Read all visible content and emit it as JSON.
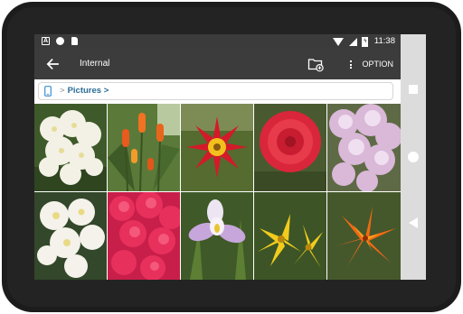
{
  "status_bar": {
    "time": "11:38",
    "battery_icon": "battery-charging-icon",
    "left_icons": [
      "text-app-notification-icon",
      "circle-app-notification-icon",
      "sd-card-icon"
    ]
  },
  "toolbar": {
    "title": "Internal",
    "back_icon": "arrow-back-icon",
    "new_folder_icon": "new-folder-icon",
    "option_label": "OPTION"
  },
  "breadcrumb": {
    "device_icon": "phone-icon",
    "separator": ">",
    "items": [
      {
        "label": "Pictures",
        "trailing_sep": ">"
      }
    ]
  },
  "gallery": {
    "items": [
      {
        "subject": "white azaleas",
        "icon": "photo-thumbnail"
      },
      {
        "subject": "red hot poker flowers",
        "icon": "photo-thumbnail"
      },
      {
        "subject": "red and yellow star flower",
        "icon": "photo-thumbnail"
      },
      {
        "subject": "red dahlia",
        "icon": "photo-thumbnail"
      },
      {
        "subject": "pink rhododendron",
        "icon": "photo-thumbnail"
      },
      {
        "subject": "white cream azaleas",
        "icon": "photo-thumbnail"
      },
      {
        "subject": "pink azalea bush",
        "icon": "photo-thumbnail"
      },
      {
        "subject": "purple white iris",
        "icon": "photo-thumbnail"
      },
      {
        "subject": "yellow lilies",
        "icon": "photo-thumbnail"
      },
      {
        "subject": "orange tiger lily",
        "icon": "photo-thumbnail"
      }
    ]
  },
  "navigation_bar": {
    "buttons": [
      "recent-apps-icon",
      "home-icon",
      "back-icon"
    ]
  },
  "colors": {
    "toolbar": "#3c3c3c",
    "status_bar": "#3b3b3b",
    "breadcrumb_accent": "#2b6c96",
    "nav_bar": "#dcdcdc"
  }
}
